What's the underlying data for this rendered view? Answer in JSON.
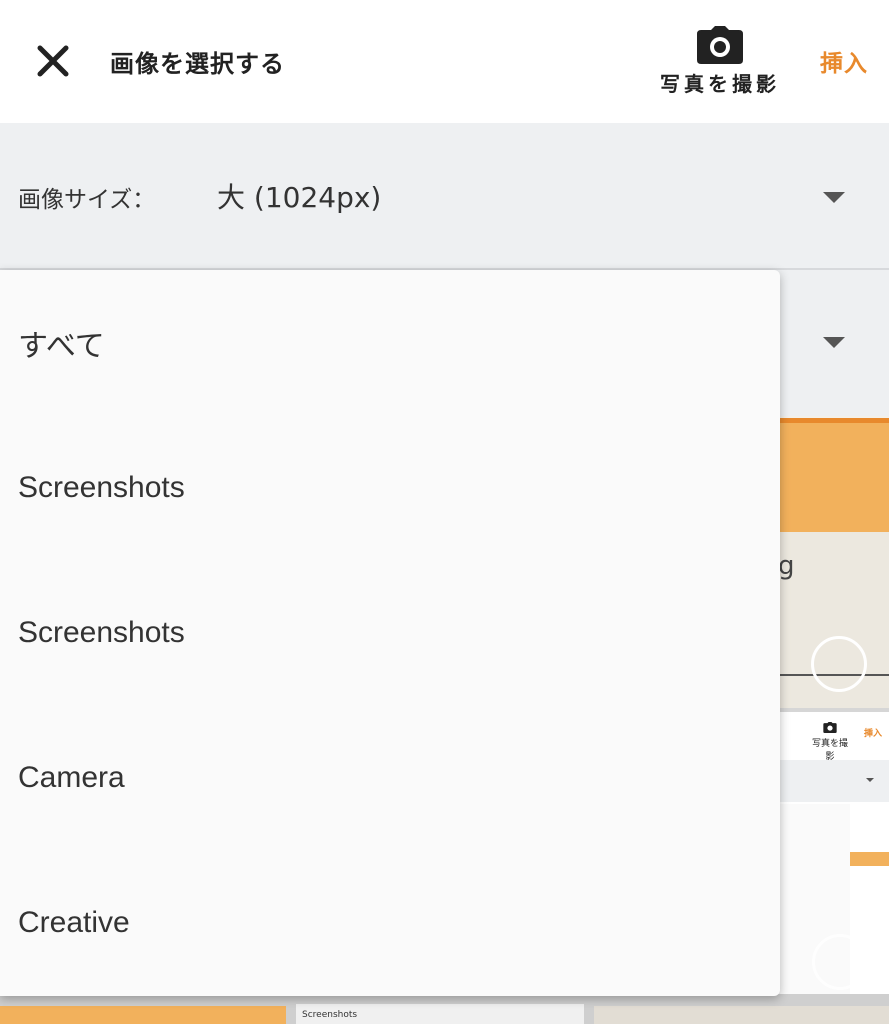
{
  "header": {
    "title": "画像を選択する",
    "camera_label": "写真を撮影",
    "insert_label": "挿入",
    "close_icon": "close-icon",
    "camera_icon": "camera-icon",
    "accent_color": "#e8892c"
  },
  "image_size": {
    "label": "画像サイズ：",
    "value": "大 (1024px)"
  },
  "album_menu": {
    "options": [
      "すべて",
      "Screenshots",
      "Screenshots",
      "Camera",
      "Creative"
    ]
  },
  "background_grid": {
    "thumb_letter": "g",
    "mini_camera_label": "写真を撮影",
    "mini_insert_label": "挿入",
    "caption": "Screenshots"
  }
}
